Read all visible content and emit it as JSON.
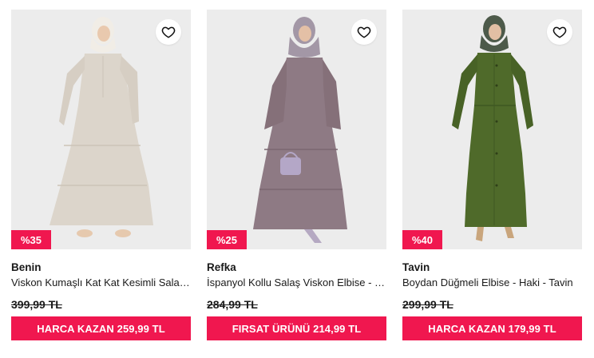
{
  "products": [
    {
      "brand": "Benin",
      "title": "Viskon Kumaşlı Kat Kat Kesimli Salaş Elbise",
      "discount": "%35",
      "old_price": "399,99 TL",
      "cta": "HARCA KAZAN 259,99 TL",
      "dress_color": "#dcd5cb",
      "hijab_color": "#f1ede6",
      "favorite_icon": "heart-outline-icon"
    },
    {
      "brand": "Refka",
      "title": "İspanyol Kollu Salaş Viskon Elbise - Lila",
      "discount": "%25",
      "old_price": "284,99 TL",
      "cta": "FIRSAT ÜRÜNÜ 214,99 TL",
      "dress_color": "#8e7a84",
      "hijab_color": "#a397a6",
      "favorite_icon": "heart-outline-icon"
    },
    {
      "brand": "Tavin",
      "title": "Boydan Düğmeli Elbise - Haki - Tavin",
      "discount": "%40",
      "old_price": "299,99 TL",
      "cta": "HARCA KAZAN 179,99 TL",
      "dress_color": "#4f6a2a",
      "hijab_color": "#4d5a4a",
      "favorite_icon": "heart-outline-icon"
    }
  ],
  "colors": {
    "accent": "#f0174f",
    "image_bg": "#ececec"
  }
}
